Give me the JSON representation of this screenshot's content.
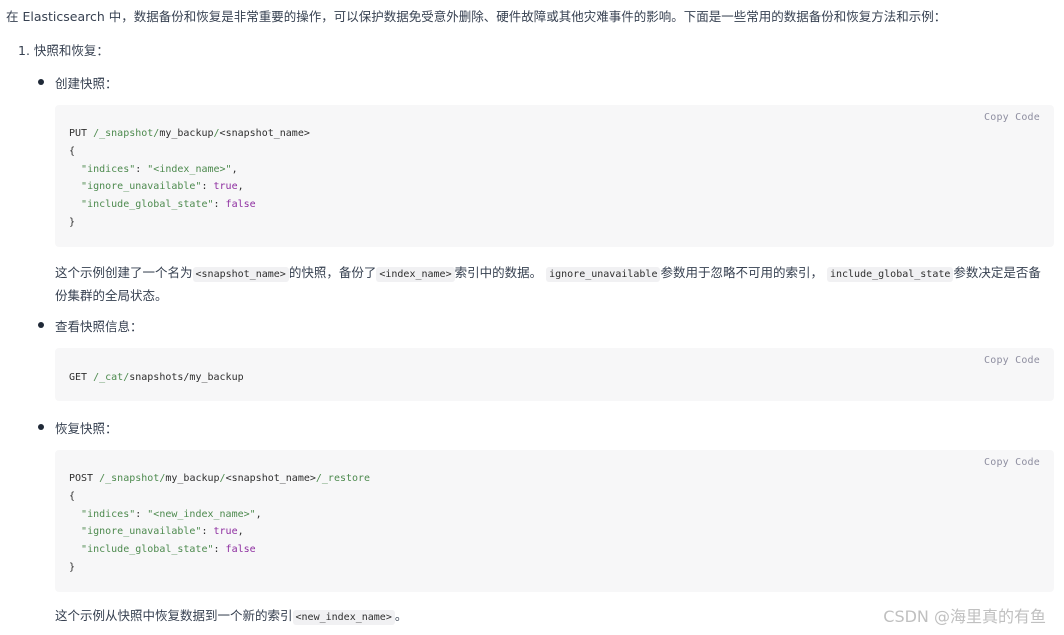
{
  "intro": "在 Elasticsearch 中，数据备份和恢复是非常重要的操作，可以保护数据免受意外删除、硬件故障或其他灾难事件的影响。下面是一些常用的数据备份和恢复方法和示例：",
  "list_item": "1. 快照和恢复：",
  "copy_label": "Copy Code",
  "sections": [
    {
      "label": "创建快照：",
      "code": {
        "method": "PUT",
        "path_a": "/_snapshot/",
        "path_b": "my_backup",
        "path_c": "/",
        "path_d": "<snapshot_name>",
        "l_open": "{",
        "k1": "\"indices\"",
        "v1": "\"<index_name>\"",
        "k2": "\"ignore_unavailable\"",
        "v2": "true",
        "k3": "\"include_global_state\"",
        "v3": "false",
        "l_close": "}"
      },
      "desc": {
        "t1": "这个示例创建了一个名为",
        "c1": "<snapshot_name>",
        "t2": "的快照，备份了",
        "c2": "<index_name>",
        "t3": "索引中的数据。",
        "c3": "ignore_unavailable",
        "t4": "参数用于忽略不可用的索引，",
        "c4": "include_global_state",
        "t5": "参数决定是否备份集群的全局状态。"
      }
    },
    {
      "label": "查看快照信息：",
      "code": {
        "method": "GET",
        "path_a": "/_cat/",
        "path_b": "snapshots/my_backup"
      }
    },
    {
      "label": "恢复快照：",
      "code": {
        "method": "POST",
        "path_a": "/_snapshot/",
        "path_b": "my_backup",
        "path_c": "/",
        "path_d": "<snapshot_name>",
        "path_e": "/_restore",
        "l_open": "{",
        "k1": "\"indices\"",
        "v1": "\"<new_index_name>\"",
        "k2": "\"ignore_unavailable\"",
        "v2": "true",
        "k3": "\"include_global_state\"",
        "v3": "false",
        "l_close": "}"
      },
      "desc": {
        "t1": "这个示例从快照中恢复数据到一个新的索引",
        "c1": "<new_index_name>",
        "t2": "。"
      }
    }
  ],
  "watermark": "CSDN @海里真的有鱼"
}
